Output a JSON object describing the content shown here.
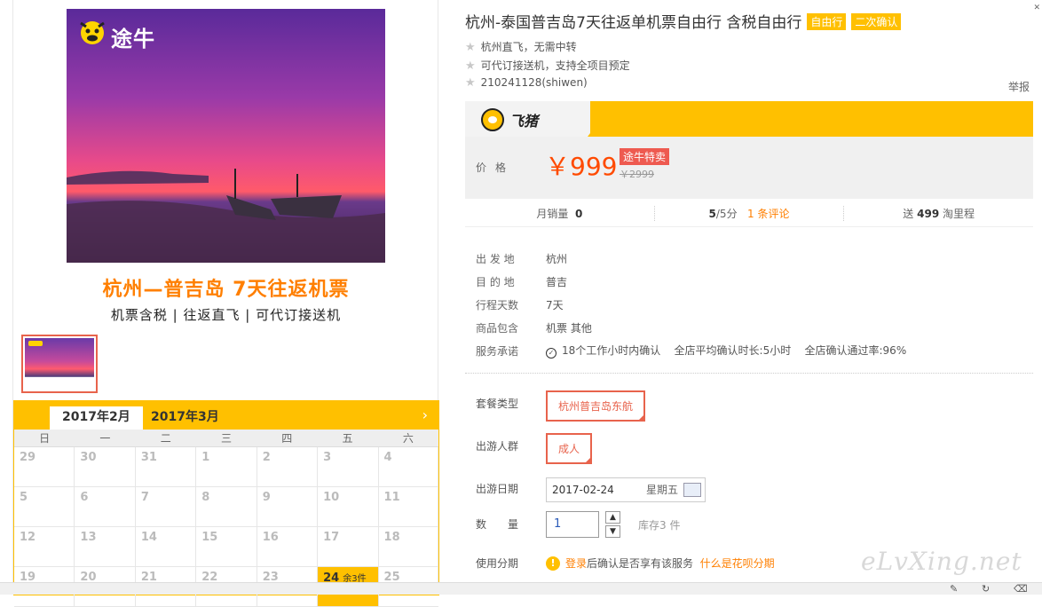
{
  "hero": {
    "logo_text": "途牛",
    "caption_line1": "杭州—普吉岛  7天往返机票",
    "caption_line2": "机票含税  |  往返直飞  |  可代订接送机"
  },
  "calendar": {
    "tabs": [
      "2017年2月",
      "2017年3月"
    ],
    "next": "›",
    "weekdays": [
      "日",
      "一",
      "二",
      "三",
      "四",
      "五",
      "六"
    ],
    "weeks": [
      [
        "29",
        "30",
        "31",
        "1",
        "2",
        "3",
        "4"
      ],
      [
        "5",
        "6",
        "7",
        "8",
        "9",
        "10",
        "11"
      ],
      [
        "12",
        "13",
        "14",
        "15",
        "16",
        "17",
        "18"
      ],
      [
        "19",
        "20",
        "21",
        "22",
        "23",
        "24",
        "25"
      ]
    ],
    "selected_day": "24",
    "selected_extra": "余3件"
  },
  "product": {
    "title": "杭州-泰国普吉岛7天往返单机票自由行 含税自由行",
    "tags": [
      "自由行",
      "二次确认"
    ],
    "features": [
      "杭州直飞，无需中转",
      "可代订接送机，支持全项目预定",
      "210241128(shiwen)"
    ],
    "report": "举报"
  },
  "feizhu": {
    "logo_text": "飞猪"
  },
  "price": {
    "label": "价格",
    "value": "￥999",
    "badge": "途牛特卖",
    "old": "￥2999"
  },
  "stats": {
    "monthly_label": "月销量",
    "monthly_value": "0",
    "score": "5",
    "score_suffix": "/5分",
    "reviews": "1 条评论",
    "points_prefix": "送",
    "points": "499",
    "points_suffix": "淘里程"
  },
  "info": [
    {
      "k": "出 发 地",
      "v": "杭州"
    },
    {
      "k": "目 的 地",
      "v": "普吉"
    },
    {
      "k": "行程天数",
      "v": "7天"
    },
    {
      "k": "商品包含",
      "v": "机票  其他"
    }
  ],
  "service": {
    "k": "服务承诺",
    "items": [
      "18个工作小时内确认",
      "全店平均确认时长:5小时",
      "全店确认通过率:96%"
    ]
  },
  "options": {
    "package_label": "套餐类型",
    "package_value": "杭州普吉岛东航",
    "crowd_label": "出游人群",
    "crowd_value": "成人",
    "date_label": "出游日期",
    "date_value": "2017-02-24",
    "weekday": "星期五",
    "qty_label": "数　　量",
    "qty_value": "1",
    "stock": "库存3 件",
    "install_label": "使用分期",
    "install_login": "登录",
    "install_text": "后确认是否享有该服务",
    "install_link": "什么是花呗分期"
  },
  "watermark": "eLvXing.net"
}
